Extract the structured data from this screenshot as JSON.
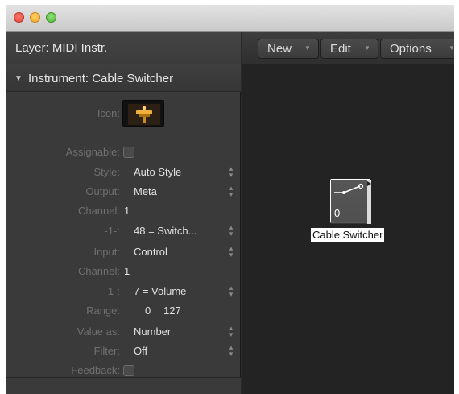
{
  "inspector": {
    "layer_label": "Layer: MIDI Instr.",
    "section_title": "Instrument: Cable Switcher",
    "icon_label": "Icon:",
    "rows": [
      {
        "label": "Assignable:",
        "kind": "checkbox"
      },
      {
        "label": "Style:",
        "value": "Auto Style",
        "kind": "popup"
      },
      {
        "label": "Output:",
        "value": "Meta",
        "kind": "popup"
      },
      {
        "label": "Channel:",
        "value": "1",
        "kind": "text"
      },
      {
        "label": "-1-:",
        "value": "48 = Switch...",
        "kind": "popup"
      },
      {
        "label": "Input:",
        "value": "Control",
        "kind": "popup"
      },
      {
        "label": "Channel:",
        "value": "1",
        "kind": "text"
      },
      {
        "label": "-1-:",
        "value": "7 = Volume",
        "kind": "popup"
      },
      {
        "label": "Range:",
        "value_min": "0",
        "value_max": "127",
        "kind": "range"
      },
      {
        "label": "Value as:",
        "value": "Number",
        "kind": "popup"
      },
      {
        "label": "Filter:",
        "value": "Off",
        "kind": "popup"
      },
      {
        "label": "Feedback:",
        "kind": "checkbox"
      }
    ]
  },
  "toolbar": {
    "new_label": "New",
    "edit_label": "Edit",
    "options_label": "Options"
  },
  "canvas": {
    "object_label": "Cable Switcher",
    "object_value": "0"
  },
  "icons": {
    "disclosure": "disclosure-triangle-down-icon",
    "stepper": "up-down-stepper-icon",
    "caret": "dropdown-caret-icon",
    "instrument_icon": "cable-switcher-icon"
  },
  "colors": {
    "panel_bg": "#3a3a3a",
    "canvas_bg": "#232323",
    "label_text": "#6f6f6f",
    "value_text": "#e0e0e0",
    "icon_accent": "#e8a52e"
  }
}
